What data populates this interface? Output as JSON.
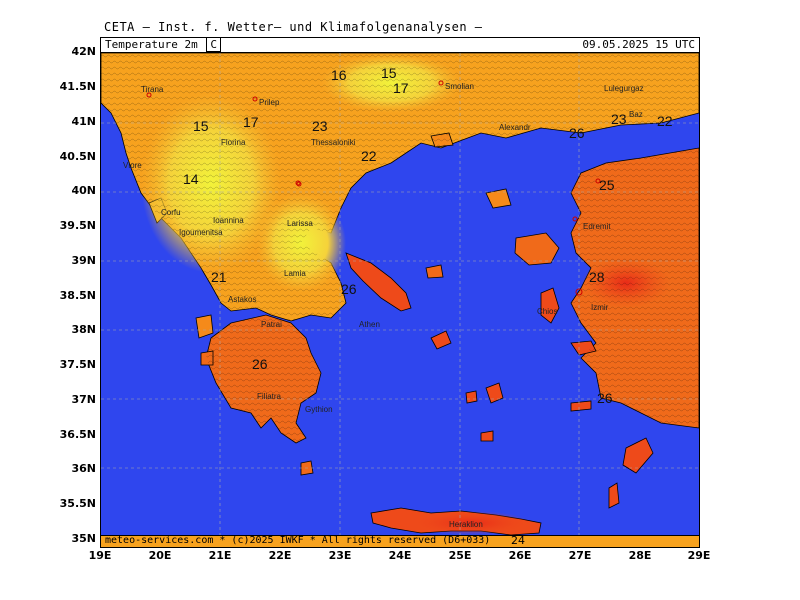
{
  "header": {
    "title": "CETA — Inst. f. Wetter— und Klimafolgenanalysen —",
    "parameter": "Temperature 2m",
    "unit": "C",
    "datetime": "09.05.2025  15 UTC"
  },
  "footer": {
    "credit": "meteo-services.com * (c)2025 IWKF * All rights reserved (D6+033)",
    "contour_label": "24"
  },
  "axes": {
    "lat_labels": [
      "42N",
      "41.5N",
      "41N",
      "40.5N",
      "40N",
      "39.5N",
      "39N",
      "38.5N",
      "38N",
      "37.5N",
      "37N",
      "36.5N",
      "36N",
      "35.5N",
      "35N"
    ],
    "lon_labels": [
      "19E",
      "20E",
      "21E",
      "22E",
      "23E",
      "24E",
      "25E",
      "26E",
      "27E",
      "28E",
      "29E"
    ]
  },
  "colors": {
    "sea": "#2f46ee",
    "t14": "#f2f23a",
    "t16": "#f5d23a",
    "t18": "#f6b82e",
    "t20": "#f7a21e",
    "t22": "#f58a1a",
    "t24": "#f06a1a",
    "t26": "#ee4a1a",
    "t28": "#e82a18"
  },
  "cities": [
    {
      "name": "Tirana"
    },
    {
      "name": "Prilep"
    },
    {
      "name": "Smolian"
    },
    {
      "name": "Lulegurgaz"
    },
    {
      "name": "Florina"
    },
    {
      "name": "Thessaloniki"
    },
    {
      "name": "Alexandr"
    },
    {
      "name": "Vlore"
    },
    {
      "name": "Corfu"
    },
    {
      "name": "Ioannina"
    },
    {
      "name": "Igoumenitsa"
    },
    {
      "name": "Larissa"
    },
    {
      "name": "Lamia"
    },
    {
      "name": "Edremit"
    },
    {
      "name": "Astakos"
    },
    {
      "name": "Patrai"
    },
    {
      "name": "Athen"
    },
    {
      "name": "Izmir"
    },
    {
      "name": "Chios"
    },
    {
      "name": "Filiatra"
    },
    {
      "name": "Gythion"
    },
    {
      "name": "Heraklion"
    },
    {
      "name": "Baz"
    }
  ],
  "contour_labels": [
    "16",
    "15",
    "17",
    "15",
    "17",
    "23",
    "22",
    "14",
    "21",
    "26",
    "26",
    "23",
    "22",
    "25",
    "28",
    "26",
    "26"
  ]
}
